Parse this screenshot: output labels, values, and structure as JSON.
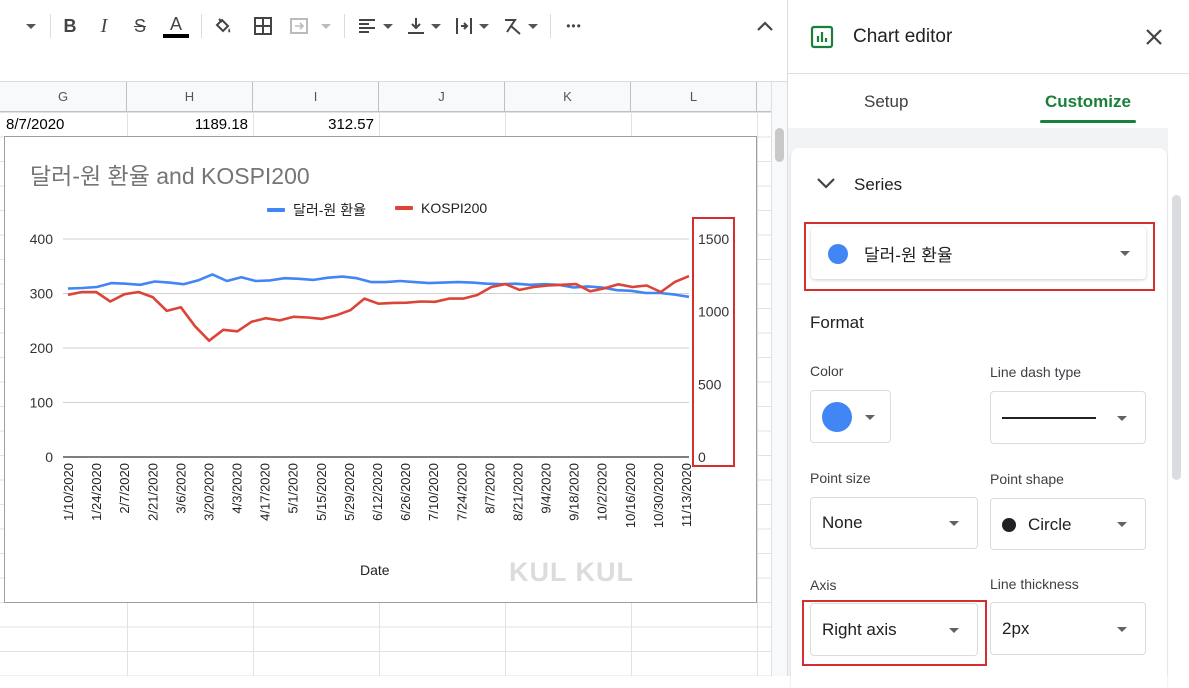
{
  "toolbar": {
    "items": [
      "more-formats-caret",
      "bold",
      "italic",
      "strikethrough",
      "text-color",
      "fill-color",
      "borders",
      "merge-cells",
      "horizontal-align",
      "vertical-align",
      "text-wrapping",
      "text-rotation",
      "more"
    ],
    "bold_label": "B",
    "italic_label": "I",
    "strike_label": "S",
    "textcolor_label": "A",
    "more_label": "•••"
  },
  "sheet": {
    "columns": [
      "G",
      "H",
      "I",
      "J",
      "K",
      "L"
    ],
    "row1": {
      "g": "8/7/2020",
      "h": "1189.18",
      "i": "312.57"
    }
  },
  "chart": {
    "title": "달러-원 환율 and KOSPI200",
    "xlabel": "Date",
    "watermark": "KUL KUL",
    "colors": {
      "usdkrw": "#4285f4",
      "kospi": "#db4437"
    },
    "legend": [
      "달러-원 환율",
      "KOSPI200"
    ]
  },
  "chart_data": {
    "type": "line",
    "title": "달러-원 환율 and KOSPI200",
    "xlabel": "Date",
    "x_tick_labels": [
      "1/10/2020",
      "1/24/2020",
      "2/7/2020",
      "2/21/2020",
      "3/6/2020",
      "3/20/2020",
      "4/3/2020",
      "4/17/2020",
      "5/1/2020",
      "5/15/2020",
      "5/29/2020",
      "6/12/2020",
      "6/26/2020",
      "7/10/2020",
      "7/24/2020",
      "8/7/2020",
      "8/21/2020",
      "9/4/2020",
      "9/18/2020",
      "10/2/2020",
      "10/16/2020",
      "10/30/2020",
      "11/13/2020"
    ],
    "left_axis": {
      "ticks": [
        0,
        100,
        200,
        300,
        400
      ],
      "ylim": [
        0,
        400
      ]
    },
    "right_axis": {
      "ticks": [
        0,
        500,
        1000,
        1500
      ],
      "ylim": [
        0,
        1500
      ]
    },
    "grid": true,
    "legend_position": "top",
    "series": [
      {
        "name": "달러-원 환율",
        "axis": "left",
        "color": "#4285f4",
        "values": [
          309,
          310,
          312,
          319,
          318,
          316,
          322,
          320,
          317,
          324,
          335,
          323,
          330,
          323,
          324,
          328,
          327,
          325,
          329,
          331,
          328,
          321,
          321,
          323,
          321,
          319,
          320,
          321,
          320,
          318,
          317,
          318,
          316,
          317,
          316,
          311,
          313,
          311,
          306,
          305,
          301,
          301,
          298,
          294
        ]
      },
      {
        "name": "KOSPI200",
        "axis": "right",
        "color": "#db4437",
        "values": [
          1116,
          1135,
          1135,
          1070,
          1120,
          1135,
          1100,
          1005,
          1030,
          900,
          800,
          875,
          865,
          930,
          955,
          940,
          965,
          960,
          950,
          975,
          1010,
          1090,
          1055,
          1060,
          1062,
          1070,
          1068,
          1090,
          1090,
          1115,
          1170,
          1190,
          1150,
          1170,
          1180,
          1185,
          1190,
          1140,
          1160,
          1188,
          1170,
          1180,
          1135,
          1205,
          1245
        ]
      }
    ]
  },
  "editor": {
    "title": "Chart editor",
    "tabs": {
      "setup": "Setup",
      "customize": "Customize"
    },
    "section": "Series",
    "series_select": "달러-원 환율",
    "format_heading": "Format",
    "color_label": "Color",
    "dash_label": "Line dash type",
    "point_size_label": "Point size",
    "point_size_value": "None",
    "point_shape_label": "Point shape",
    "point_shape_value": "Circle",
    "axis_label": "Axis",
    "axis_value": "Right axis",
    "thickness_label": "Line thickness",
    "thickness_value": "2px",
    "accent": "#188038",
    "series_color": "#4285f4"
  }
}
